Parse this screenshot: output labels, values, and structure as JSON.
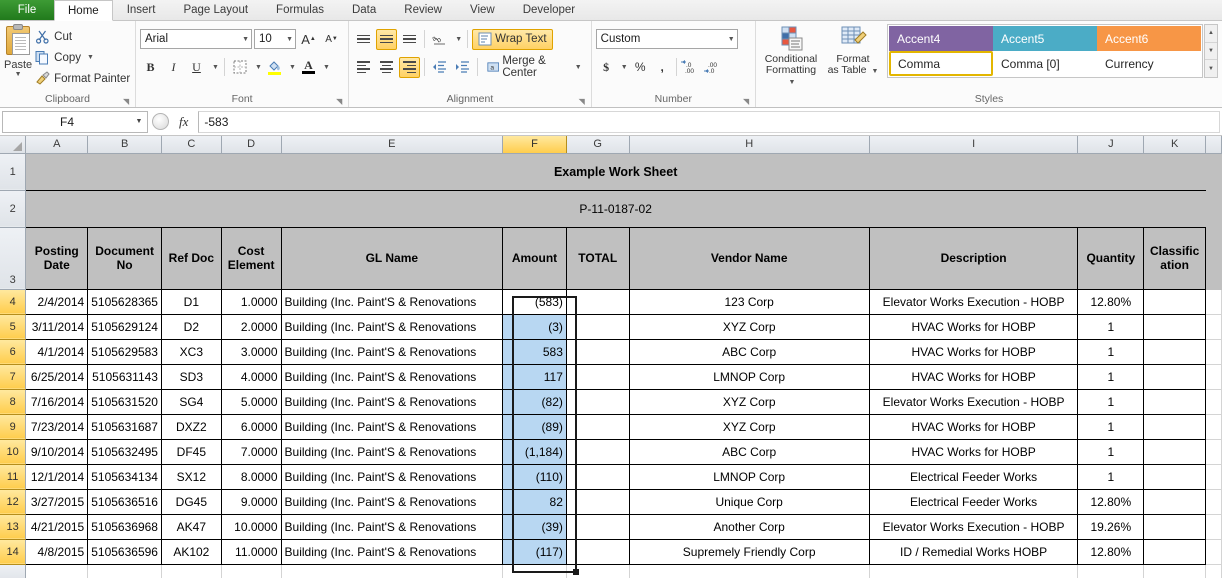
{
  "tabs": {
    "file": "File",
    "items": [
      "Home",
      "Insert",
      "Page Layout",
      "Formulas",
      "Data",
      "Review",
      "View",
      "Developer"
    ],
    "active": "Home"
  },
  "ribbon": {
    "clipboard": {
      "group_label": "Clipboard",
      "paste": "Paste",
      "cut": "Cut",
      "copy": "Copy",
      "format_painter": "Format Painter"
    },
    "font": {
      "group_label": "Font",
      "font_name": "Arial",
      "font_size": "10",
      "grow_font": "A",
      "shrink_font": "A",
      "bold": "B",
      "italic": "I",
      "underline": "U",
      "borders": "Borders",
      "fill_color": "Fill Color",
      "font_color": "A"
    },
    "alignment": {
      "group_label": "Alignment",
      "wrap_text": "Wrap Text",
      "merge_center": "Merge & Center"
    },
    "number": {
      "group_label": "Number",
      "format": "Custom",
      "accounting": "$",
      "percent": "%",
      "comma": ",",
      "increase_decimal": ".00",
      "decrease_decimal": ".00"
    },
    "styles": {
      "group_label": "Styles",
      "conditional_formatting": "Conditional\nFormatting",
      "conditional_formatting_l1": "Conditional",
      "conditional_formatting_l2": "Formatting",
      "format_as_table_l1": "Format",
      "format_as_table_l2": "as Table",
      "gallery": [
        {
          "label": "Accent4",
          "bg": "#8064a2",
          "fg": "#ffffff",
          "selected": false
        },
        {
          "label": "Accent5",
          "bg": "#4bacc6",
          "fg": "#ffffff",
          "selected": false
        },
        {
          "label": "Accent6",
          "bg": "#f79646",
          "fg": "#ffffff",
          "selected": false
        },
        {
          "label": "Comma",
          "bg": "#ffffff",
          "fg": "#262626",
          "selected": true
        },
        {
          "label": "Comma [0]",
          "bg": "#ffffff",
          "fg": "#262626",
          "selected": false
        },
        {
          "label": "Currency",
          "bg": "#ffffff",
          "fg": "#262626",
          "selected": false
        }
      ]
    }
  },
  "formula_bar": {
    "name_box": "F4",
    "formula": "-583"
  },
  "grid": {
    "column_letters": [
      "A",
      "B",
      "C",
      "D",
      "E",
      "F",
      "G",
      "H",
      "I",
      "J",
      "K"
    ],
    "selected_column": "F",
    "row_numbers": [
      "1",
      "2",
      "3",
      "4",
      "5",
      "6",
      "7",
      "8",
      "9",
      "10",
      "11",
      "12",
      "13",
      "14"
    ],
    "selected_rows": [
      "4",
      "5",
      "6",
      "7",
      "8",
      "9",
      "10",
      "11",
      "12",
      "13",
      "14"
    ],
    "title": "Example Work Sheet",
    "subtitle": "P-11-0187-02",
    "headers": [
      "Posting Date",
      "Document No",
      "Ref Doc",
      "Cost Element",
      "GL Name",
      "Amount",
      "TOTAL",
      "Vendor Name",
      "Description",
      "Quantity",
      "Classific ation"
    ],
    "header_lines": [
      [
        "Posting",
        "Date"
      ],
      [
        "Document",
        "No"
      ],
      [
        "Ref Doc"
      ],
      [
        "Cost",
        "Element"
      ],
      [
        "GL Name"
      ],
      [
        "Amount"
      ],
      [
        "TOTAL"
      ],
      [
        "Vendor Name"
      ],
      [
        "Description"
      ],
      [
        "Quantity"
      ],
      [
        "Classific",
        "ation"
      ]
    ],
    "rows": [
      {
        "row": "4",
        "posting_date": "2/4/2014",
        "document_no": "5105628365",
        "ref_doc": "D1",
        "cost_element": "1.0000",
        "gl_name": "Building (Inc. Paint'S & Renovations",
        "amount": "(583)",
        "total": "",
        "vendor_name": "123 Corp",
        "description": "Elevator Works Execution - HOBP",
        "quantity": "12.80%",
        "classification": ""
      },
      {
        "row": "5",
        "posting_date": "3/11/2014",
        "document_no": "5105629124",
        "ref_doc": "D2",
        "cost_element": "2.0000",
        "gl_name": "Building (Inc. Paint'S & Renovations",
        "amount": "(3)",
        "total": "",
        "vendor_name": "XYZ Corp",
        "description": "HVAC Works for HOBP",
        "quantity": "1",
        "classification": ""
      },
      {
        "row": "6",
        "posting_date": "4/1/2014",
        "document_no": "5105629583",
        "ref_doc": "XC3",
        "cost_element": "3.0000",
        "gl_name": "Building (Inc. Paint'S & Renovations",
        "amount": "583",
        "total": "",
        "vendor_name": "ABC Corp",
        "description": "HVAC Works for HOBP",
        "quantity": "1",
        "classification": ""
      },
      {
        "row": "7",
        "posting_date": "6/25/2014",
        "document_no": "5105631143",
        "ref_doc": "SD3",
        "cost_element": "4.0000",
        "gl_name": "Building (Inc. Paint'S & Renovations",
        "amount": "117",
        "total": "",
        "vendor_name": "LMNOP Corp",
        "description": "HVAC Works for HOBP",
        "quantity": "1",
        "classification": ""
      },
      {
        "row": "8",
        "posting_date": "7/16/2014",
        "document_no": "5105631520",
        "ref_doc": "SG4",
        "cost_element": "5.0000",
        "gl_name": "Building (Inc. Paint'S & Renovations",
        "amount": "(82)",
        "total": "",
        "vendor_name": "XYZ Corp",
        "description": "Elevator Works Execution - HOBP",
        "quantity": "1",
        "classification": ""
      },
      {
        "row": "9",
        "posting_date": "7/23/2014",
        "document_no": "5105631687",
        "ref_doc": "DXZ2",
        "cost_element": "6.0000",
        "gl_name": "Building (Inc. Paint'S & Renovations",
        "amount": "(89)",
        "total": "",
        "vendor_name": "XYZ Corp",
        "description": "HVAC Works for HOBP",
        "quantity": "1",
        "classification": ""
      },
      {
        "row": "10",
        "posting_date": "9/10/2014",
        "document_no": "5105632495",
        "ref_doc": "DF45",
        "cost_element": "7.0000",
        "gl_name": "Building (Inc. Paint'S & Renovations",
        "amount": "(1,184)",
        "total": "",
        "vendor_name": "ABC Corp",
        "description": "HVAC Works for HOBP",
        "quantity": "1",
        "classification": ""
      },
      {
        "row": "11",
        "posting_date": "12/1/2014",
        "document_no": "5105634134",
        "ref_doc": "SX12",
        "cost_element": "8.0000",
        "gl_name": "Building (Inc. Paint'S & Renovations",
        "amount": "(110)",
        "total": "",
        "vendor_name": "LMNOP Corp",
        "description": "Electrical Feeder Works",
        "quantity": "1",
        "classification": ""
      },
      {
        "row": "12",
        "posting_date": "3/27/2015",
        "document_no": "5105636516",
        "ref_doc": "DG45",
        "cost_element": "9.0000",
        "gl_name": "Building (Inc. Paint'S & Renovations",
        "amount": "82",
        "total": "",
        "vendor_name": "Unique Corp",
        "description": "Electrical Feeder Works",
        "quantity": "12.80%",
        "classification": ""
      },
      {
        "row": "13",
        "posting_date": "4/21/2015",
        "document_no": "5105636968",
        "ref_doc": "AK47",
        "cost_element": "10.0000",
        "gl_name": "Building (Inc. Paint'S & Renovations",
        "amount": "(39)",
        "total": "",
        "vendor_name": "Another Corp",
        "description": "Elevator Works Execution - HOBP",
        "quantity": "19.26%",
        "classification": ""
      },
      {
        "row": "14",
        "posting_date": "4/8/2015",
        "document_no": "5105636596",
        "ref_doc": "AK102",
        "cost_element": "11.0000",
        "gl_name": "Building (Inc. Paint'S & Renovations",
        "amount": "(117)",
        "total": "",
        "vendor_name": "Supremely Friendly Corp",
        "description": "ID / Remedial Works HOBP",
        "quantity": "12.80%",
        "classification": ""
      }
    ]
  },
  "colors": {
    "selection_fill": "#b8d7f2",
    "header_fill": "#c0c0c0",
    "row_header_selected": "#ffcd4d",
    "file_tab_green": "#217a1c"
  }
}
